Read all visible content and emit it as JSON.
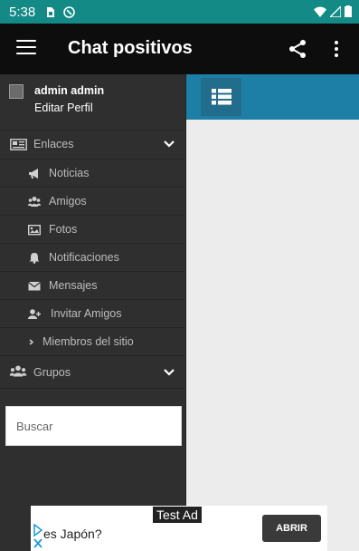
{
  "status_bar": {
    "time": "5:38"
  },
  "app_bar": {
    "title": "Chat positivos",
    "icons": [
      "menu-icon",
      "share-icon",
      "more-vert-icon"
    ]
  },
  "profile": {
    "name": "admin admin",
    "edit_label": "Editar Perfil"
  },
  "nav": {
    "links_section": {
      "label": "Enlaces",
      "icon": "newspaper-icon"
    },
    "items": [
      {
        "label": "Noticias",
        "icon": "bullhorn-icon"
      },
      {
        "label": "Amigos",
        "icon": "users-icon"
      },
      {
        "label": "Fotos",
        "icon": "image-icon"
      },
      {
        "label": "Notificaciones",
        "icon": "bell-icon"
      },
      {
        "label": "Mensajes",
        "icon": "envelope-icon"
      },
      {
        "label": "Invitar Amigos",
        "icon": "user-plus-icon"
      },
      {
        "label": "Miembros del sitio",
        "icon": "chevron-right-icon"
      }
    ],
    "groups_section": {
      "label": "Grupos",
      "icon": "users-icon"
    }
  },
  "search": {
    "placeholder": "Buscar"
  },
  "ad": {
    "label": "Test Ad",
    "text": "es Japón?",
    "button": "ABRIR"
  },
  "colors": {
    "status_bar": "#138a86",
    "app_bar": "#0d0d0d",
    "drawer": "#2f2f2f",
    "content_bar": "#1d7fa6",
    "content_bg": "#ececec"
  }
}
